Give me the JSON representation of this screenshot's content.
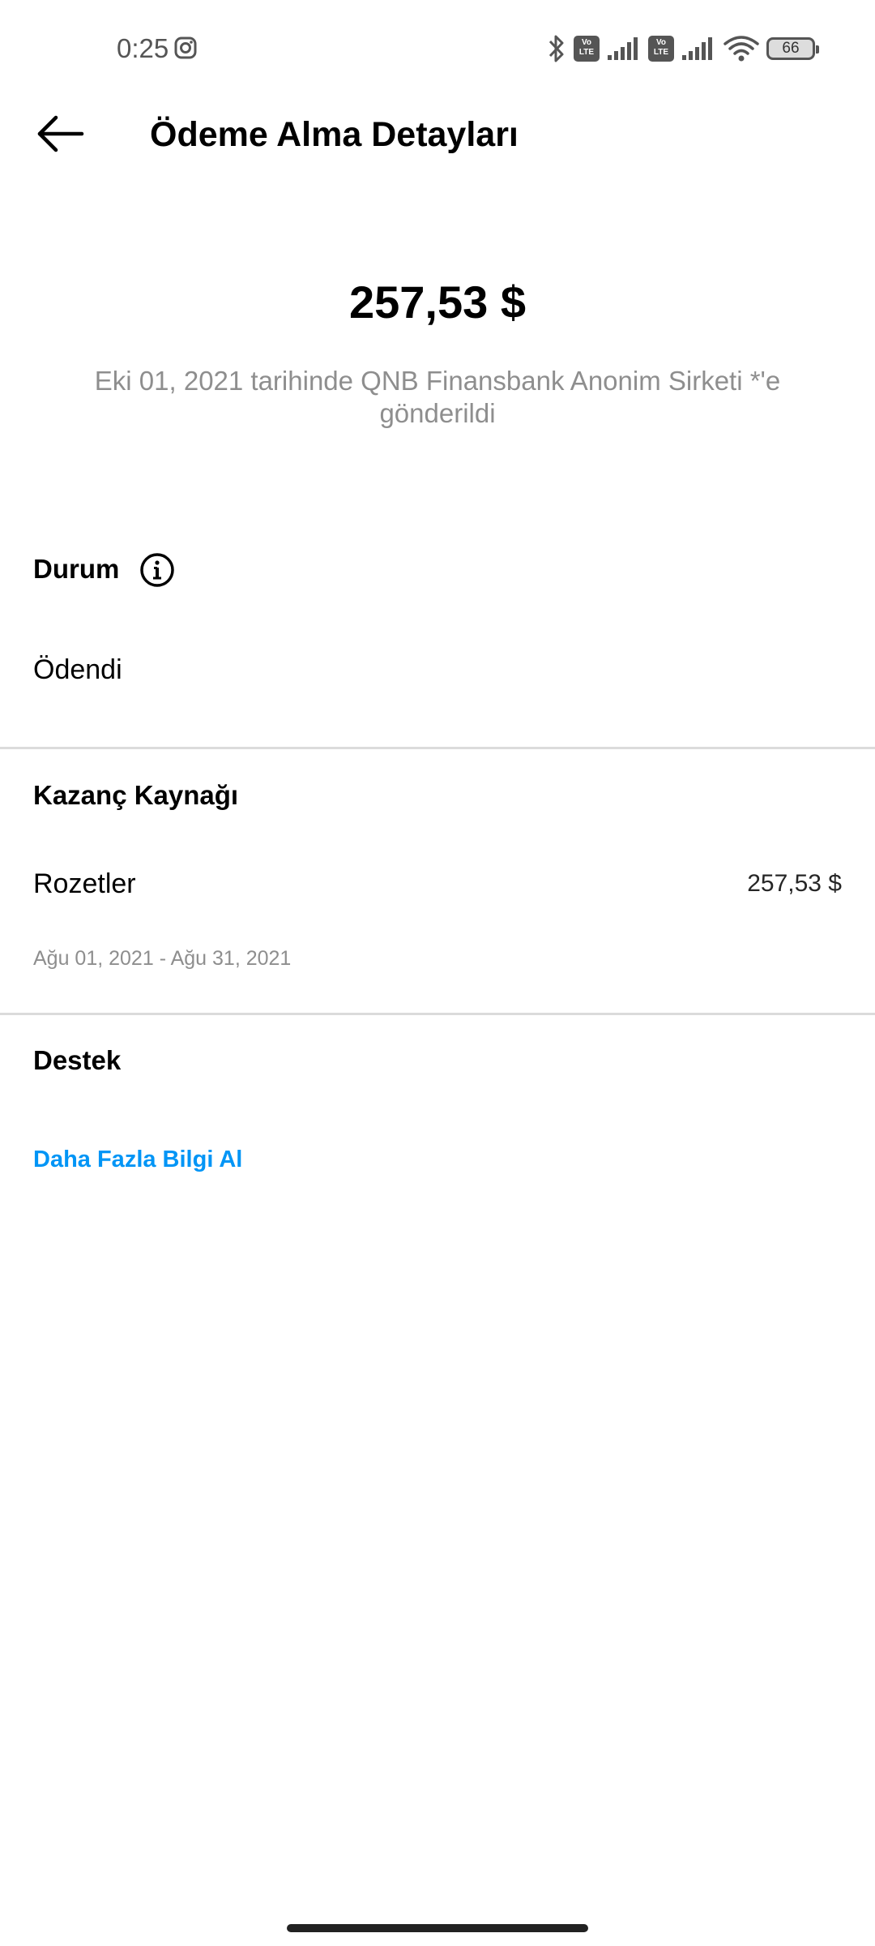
{
  "status_bar": {
    "time": "0:25",
    "battery": "66",
    "volte_label_1": "Vo\nLTE",
    "volte_label_2": "Vo\nLTE",
    "icons": [
      "instagram-icon",
      "bluetooth-icon",
      "volte-icon",
      "signal-icon",
      "volte-icon",
      "signal-icon",
      "wifi-icon",
      "battery-icon"
    ]
  },
  "header": {
    "title": "Ödeme Alma Detayları",
    "back_icon": "arrow-left-icon"
  },
  "payout": {
    "amount": "257,53 $",
    "description": "Eki 01, 2021 tarihinde QNB Finansbank Anonim Sirketi *'e gönderildi"
  },
  "status_section": {
    "title": "Durum",
    "info_icon": "info-icon",
    "value": "Ödendi"
  },
  "earnings_section": {
    "title": "Kazanç Kaynağı",
    "items": [
      {
        "label": "Rozetler",
        "amount": "257,53 $",
        "period": "Ağu 01, 2021 - Ağu 31, 2021"
      }
    ]
  },
  "support_section": {
    "title": "Destek",
    "link_label": "Daha Fazla Bilgi Al"
  },
  "colors": {
    "link": "#0095f6",
    "secondary_text": "#8e8e8e",
    "divider": "#dbdbdb"
  }
}
